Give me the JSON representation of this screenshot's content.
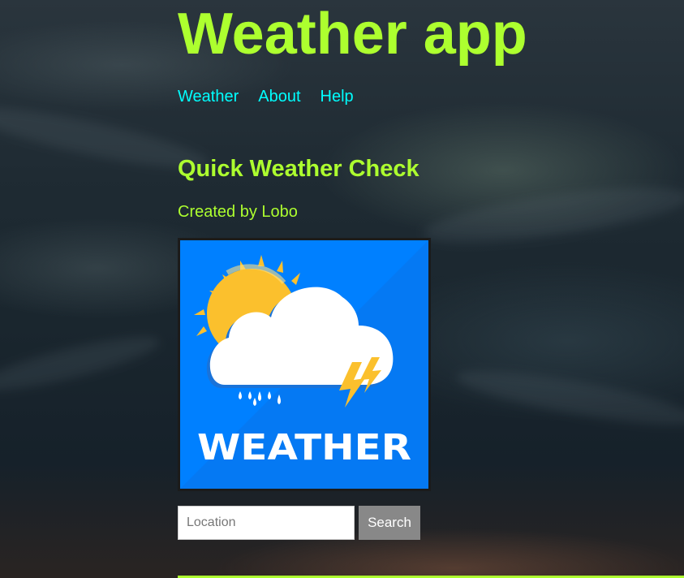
{
  "header": {
    "title": "Weather app"
  },
  "nav": {
    "items": [
      {
        "label": "Weather"
      },
      {
        "label": "About"
      },
      {
        "label": "Help"
      }
    ]
  },
  "main": {
    "heading": "Quick Weather Check",
    "credit": "Created by Lobo",
    "logo": {
      "text": "WEATHER",
      "icon": "sun-cloud-lightning-icon"
    }
  },
  "search": {
    "placeholder": "Location",
    "value": "",
    "button_label": "Search"
  },
  "colors": {
    "accent": "#adff2f",
    "link": "#00ffff",
    "logo_background": "#0080ff",
    "button": "#888888"
  }
}
